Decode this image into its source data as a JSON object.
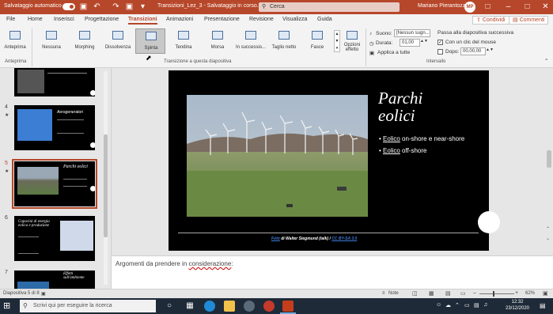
{
  "titlebar": {
    "autosave_label": "Salvataggio automatico",
    "autosave_state": "on",
    "doc_title": "Transizioni_Lez_3 - Salvataggio in corso...",
    "search_placeholder": "Cerca",
    "user_name": "Mariano Pierantozzi",
    "user_initials": "MP"
  },
  "tabs": [
    "File",
    "Home",
    "Inserisci",
    "Progettazione",
    "Transizioni",
    "Animazioni",
    "Presentazione",
    "Revisione",
    "Visualizza",
    "Guida"
  ],
  "active_tab": "Transizioni",
  "share_label": "Condividi",
  "comments_label": "Commenti",
  "ribbon": {
    "preview_label": "Anteprima",
    "preview_group": "Anteprima",
    "transitions": [
      "Nessuna",
      "Morphing",
      "Dissolvenza",
      "Spinta",
      "Tendina",
      "Morsa",
      "In successio...",
      "Taglio netto",
      "Fasce"
    ],
    "selected_transition": "Spinta",
    "transitions_group": "Transizione a questa diapositiva",
    "effect_options_label": "Opzioni effetto",
    "sound_label": "Suono:",
    "sound_value": "[Nessun sugn...",
    "duration_label": "Durata:",
    "duration_value": "01,00",
    "apply_all_label": "Applica a tutte",
    "advance_label": "Passa alla diapositiva successiva",
    "on_click_label": "Con un clic del mouse",
    "after_label": "Dopo:",
    "after_value": "00,00,00",
    "timing_group": "Intervallo"
  },
  "thumbnails": [
    {
      "num": "",
      "title": ""
    },
    {
      "num": "4",
      "title": "Aerogeneratori"
    },
    {
      "num": "5",
      "title": "Parchi eolici"
    },
    {
      "num": "6",
      "title": "Capacità di energia eolica e produzione"
    },
    {
      "num": "7",
      "title": "Effetti sull'ambiente"
    }
  ],
  "slide": {
    "title_line1": "Parchi",
    "title_line2": "eolici",
    "bullets": [
      {
        "link": "Eolico",
        "rest": " on-shore e near-shore"
      },
      {
        "link": "Eolico",
        "rest": " off-shore"
      }
    ],
    "caption_link1": "Foto",
    "caption_mid": " di Walter Siegmund (talk) / ",
    "caption_link2": "CC BY-SA 3.0"
  },
  "notes": {
    "prefix": "Argomenti da prendere in ",
    "link": "considerazione",
    "suffix": ":"
  },
  "status": {
    "slide_info": "Diapositiva 5 di 8",
    "notes_label": "Note",
    "zoom": "62%"
  },
  "taskbar": {
    "search_placeholder": "Scrivi qui per eseguire la ricerca",
    "time": "12:32",
    "date": "23/12/2020"
  },
  "colors": {
    "accent": "#b7472a",
    "link_blue": "#3c7dd9"
  }
}
